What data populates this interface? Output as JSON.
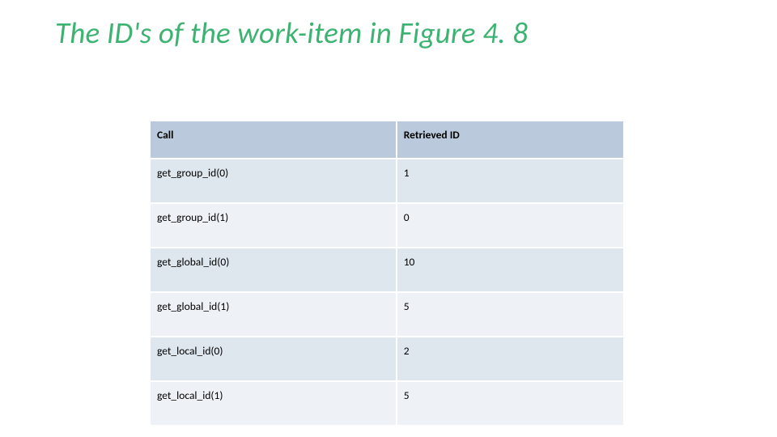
{
  "title": "The ID's of the work-item in Figure 4. 8",
  "chart_data": {
    "type": "table",
    "title": "The ID's of the work-item in Figure 4. 8",
    "headers": [
      "Call",
      "Retrieved ID"
    ],
    "rows": [
      [
        "get_group_id(0)",
        "1"
      ],
      [
        "get_group_id(1)",
        "0"
      ],
      [
        "get_global_id(0)",
        "10"
      ],
      [
        "get_global_id(1)",
        "5"
      ],
      [
        "get_local_id(0)",
        "2"
      ],
      [
        "get_local_id(1)",
        "5"
      ]
    ]
  }
}
